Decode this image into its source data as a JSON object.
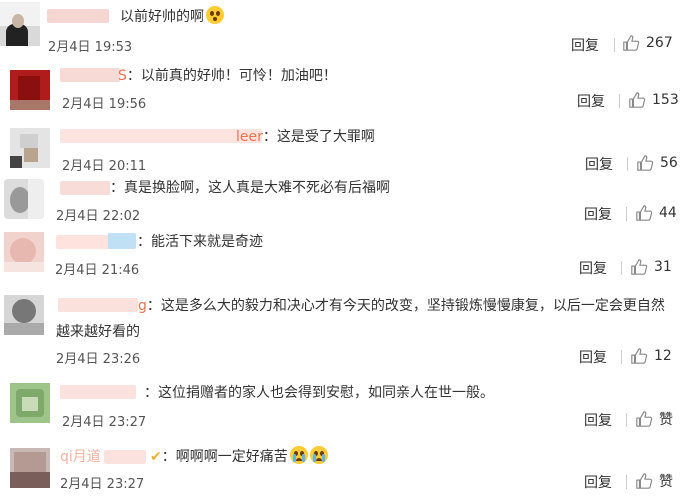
{
  "comments": [
    {
      "text": "以前好帅的啊",
      "emoji": "flushed-face-emoji",
      "date": "2月4日 19:53",
      "reply": "回复",
      "likes": "267"
    },
    {
      "name_suffix": "S",
      "text": "：以前真的好帅！可怜！加油吧！",
      "date": "2月4日 19:56",
      "reply": "回复",
      "likes": "153"
    },
    {
      "name_suffix": "leer",
      "text": "：这是受了大罪啊",
      "date": "2月4日 20:11",
      "reply": "回复",
      "likes": "56"
    },
    {
      "text": "：真是换脸啊，这人真是大难不死必有后福啊",
      "date": "2月4日 22:02",
      "reply": "回复",
      "likes": "44"
    },
    {
      "text": "：能活下来就是奇迹",
      "date": "2月4日 21:46",
      "reply": "回复",
      "likes": "31"
    },
    {
      "name_suffix": "g",
      "text": "：这是多么大的毅力和决心才有今天的改变，坚持锻炼慢慢康复，以后一定会更自然",
      "text_line2": "越来越好看的",
      "date": "2月4日 23:26",
      "reply": "回复",
      "likes": "12"
    },
    {
      "text": "：这位捐赠者的家人也会得到安慰，如同亲人在世一般。",
      "date": "2月4日 23:27",
      "reply": "回复",
      "likes": "赞"
    },
    {
      "name_prefix": "qi月道",
      "text": "：啊啊啊一定好痛苦",
      "emoji": "crying-face-emoji",
      "date": "2月4日 23:27",
      "reply": "回复",
      "likes": "赞"
    }
  ]
}
